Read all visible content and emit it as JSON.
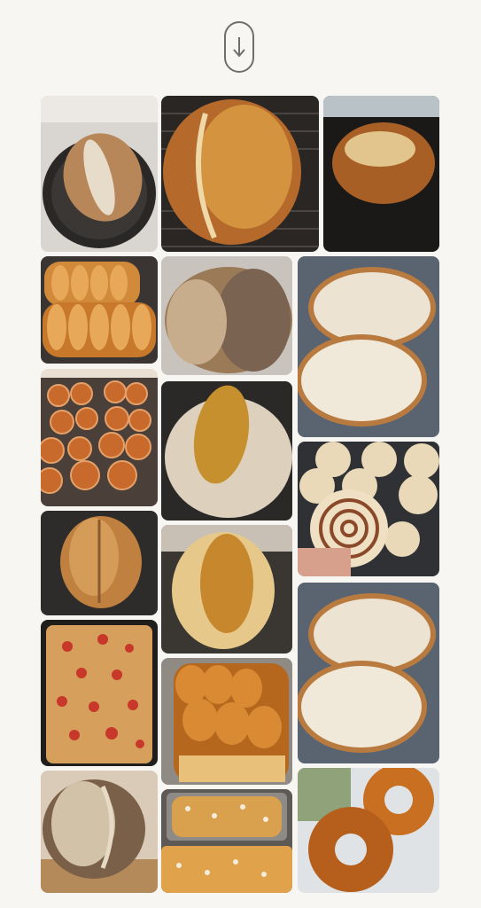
{
  "header": {
    "download_icon": "arrow-down-circle-icon"
  },
  "gallery": {
    "tiles": [
      {
        "id": "t1",
        "subject": "cast-iron-sourdough"
      },
      {
        "id": "t2",
        "subject": "rustic-loaf-on-rack"
      },
      {
        "id": "t3",
        "subject": "batard-dark-background"
      },
      {
        "id": "t4",
        "subject": "milk-bread-loaves"
      },
      {
        "id": "t5",
        "subject": "seeded-boule"
      },
      {
        "id": "t6",
        "subject": "sliced-loaf-halves"
      },
      {
        "id": "t7",
        "subject": "cinnamon-rolls-tray"
      },
      {
        "id": "t8",
        "subject": "scored-boule"
      },
      {
        "id": "t9",
        "subject": "cinnamon-roll-closeup"
      },
      {
        "id": "t10",
        "subject": "round-loaf-dark"
      },
      {
        "id": "t11",
        "subject": "golden-loaf-in-hand"
      },
      {
        "id": "t12",
        "subject": "tomato-focaccia"
      },
      {
        "id": "t13",
        "subject": "brioche-loaf"
      },
      {
        "id": "t14",
        "subject": "sliced-loaf-halves-2"
      },
      {
        "id": "t15",
        "subject": "sourdough-on-board"
      },
      {
        "id": "t16",
        "subject": "almond-milk-bread-pans"
      },
      {
        "id": "t17",
        "subject": "bread-rings"
      }
    ]
  }
}
